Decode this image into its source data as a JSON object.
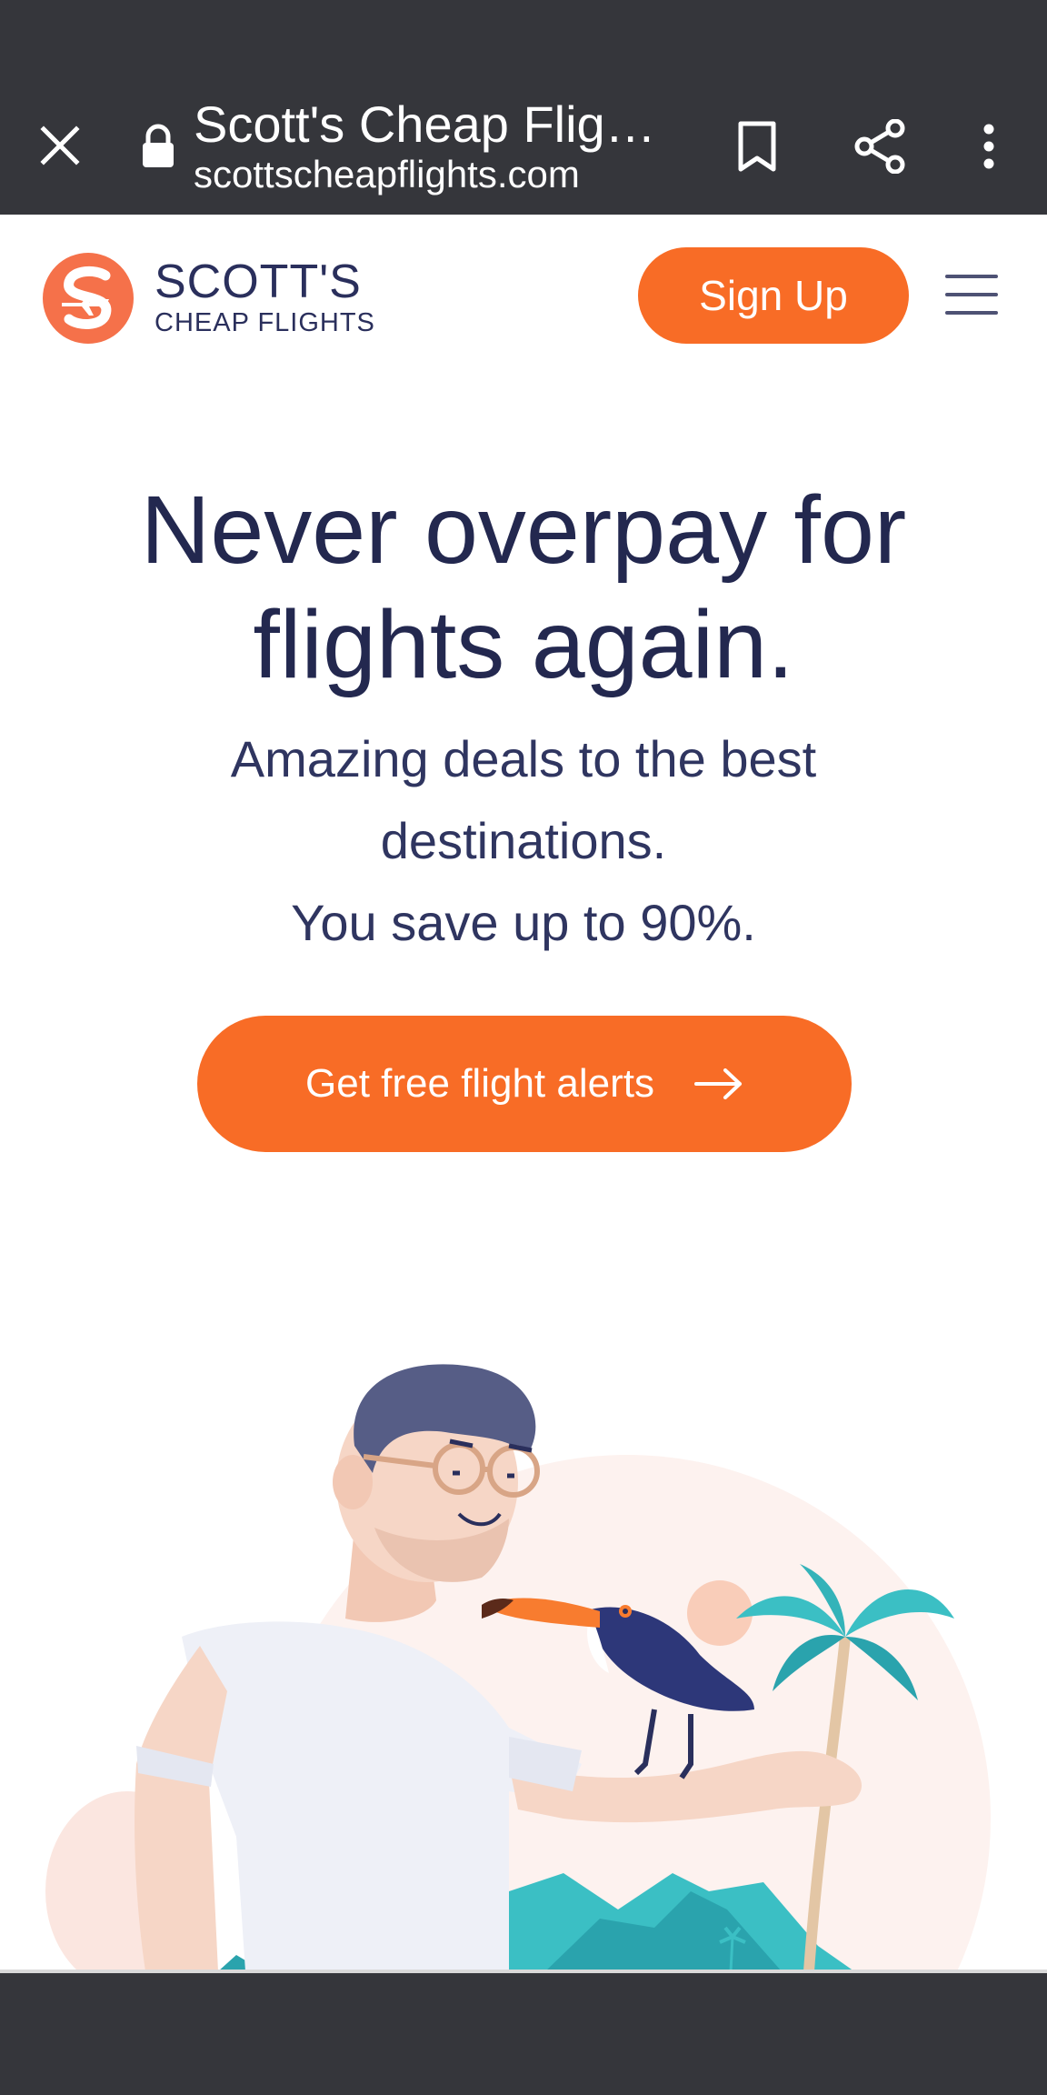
{
  "browser": {
    "page_title": "Scott's Cheap Flig…",
    "url": "scottscheapflights.com",
    "icons": [
      "close-icon",
      "lock-icon",
      "bookmark-icon",
      "share-icon",
      "more-vert-icon"
    ]
  },
  "site": {
    "logo_line1": "SCOTT'S",
    "logo_line2": "CHEAP FLIGHTS",
    "signup_label": "Sign Up",
    "menu_icon": "hamburger-icon"
  },
  "hero": {
    "title_line1": "Never overpay for",
    "title_line2": "flights again.",
    "subtitle_line1": "Amazing deals to the best",
    "subtitle_line2": "destinations.",
    "subtitle_line3": "You save up to 90%.",
    "cta_label": "Get free flight alerts",
    "cta_icon": "arrow-right-icon"
  },
  "colors": {
    "brand_orange": "#f86c26",
    "navy": "#23284f",
    "chrome": "#35363b",
    "teal": "#3bbfc4"
  }
}
